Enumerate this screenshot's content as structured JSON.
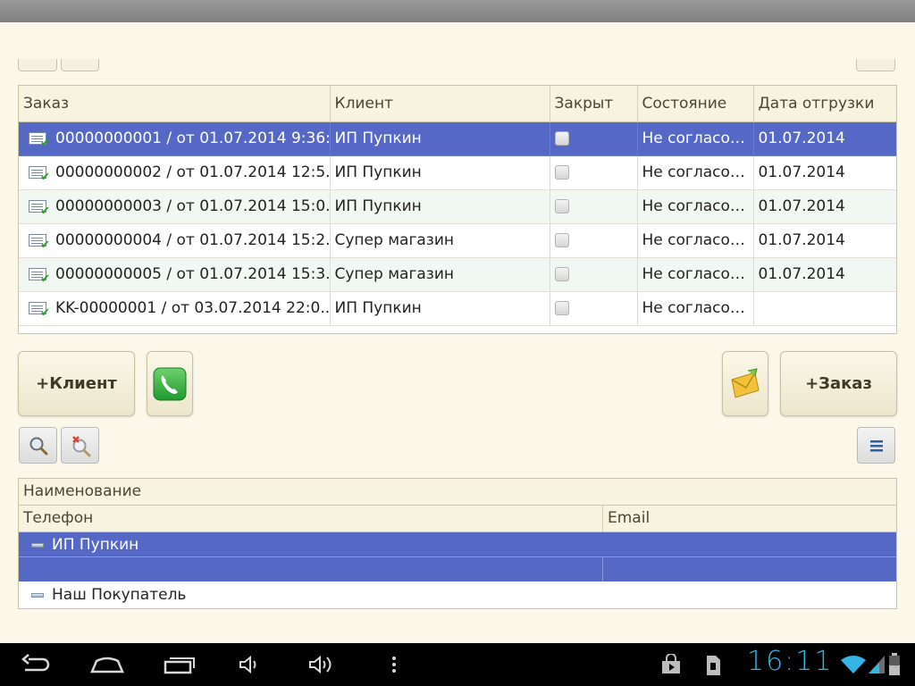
{
  "orders": {
    "columns": [
      "Заказ",
      "Клиент",
      "Закрыт",
      "Состояние",
      "Дата отгрузки"
    ],
    "rows": [
      {
        "order": "00000000001 / от 01.07.2014 9:36:...",
        "client": "ИП Пупкин",
        "closed": false,
        "state": "Не согласован",
        "ship_date": "01.07.2014"
      },
      {
        "order": "00000000002 / от 01.07.2014 12:5...",
        "client": "ИП Пупкин",
        "closed": false,
        "state": "Не согласован",
        "ship_date": "01.07.2014"
      },
      {
        "order": "00000000003 / от 01.07.2014 15:0...",
        "client": "ИП Пупкин",
        "closed": false,
        "state": "Не согласован",
        "ship_date": "01.07.2014"
      },
      {
        "order": "00000000004 / от 01.07.2014 15:2...",
        "client": "Супер магазин",
        "closed": false,
        "state": "Не согласован",
        "ship_date": "01.07.2014"
      },
      {
        "order": "00000000005 / от 01.07.2014 15:3...",
        "client": "Супер магазин",
        "closed": false,
        "state": "Не согласован",
        "ship_date": "01.07.2014"
      },
      {
        "order": "KK-00000001 / от 03.07.2014 22:0...",
        "client": "ИП Пупкин",
        "closed": false,
        "state": "Не согласован",
        "ship_date": ""
      }
    ],
    "selected_row": 0
  },
  "buttons": {
    "add_client": "+Клиент",
    "add_order": "+Заказ"
  },
  "clients": {
    "header_name": "Наименование",
    "header_phone": "Телефон",
    "header_email": "Email",
    "rows": [
      {
        "name": "ИП Пупкин",
        "phone": "",
        "email": "",
        "selected": true
      },
      {
        "name": "Наш Покупатель",
        "phone": "",
        "email": "",
        "selected": false
      }
    ]
  },
  "status_bar": {
    "time": "16:11"
  },
  "colors": {
    "selection": "#5668c6",
    "background": "#fbf8e9",
    "clock": "#33b5e5"
  }
}
